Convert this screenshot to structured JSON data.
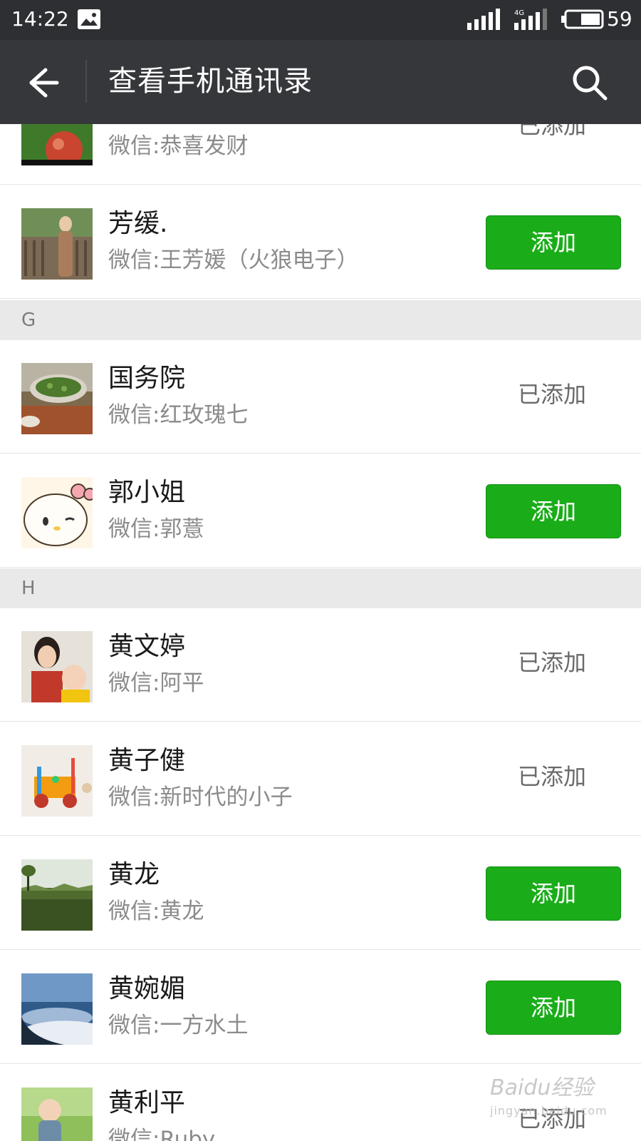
{
  "status_bar": {
    "time": "14:22",
    "battery_level": "59",
    "network": "4G"
  },
  "header": {
    "title": "查看手机通讯录",
    "back_icon": "arrow-left-icon",
    "search_icon": "search-icon"
  },
  "colors": {
    "header_bg": "#36373b",
    "status_bg": "#2e2f33",
    "add_button": "#1aad19",
    "section_bg": "#e9e9ea"
  },
  "list": {
    "rows": [
      {
        "name": "",
        "wechat": "微信:恭喜发财",
        "status": "已添加"
      },
      {
        "name": "芳缓.",
        "wechat": "微信:王芳媛（火狼电子）",
        "action": "添加"
      },
      {
        "section": "G"
      },
      {
        "name": "国务院",
        "wechat": "微信:红玫瑰七",
        "status": "已添加"
      },
      {
        "name": "郭小姐",
        "wechat": "微信:郭薏",
        "action": "添加"
      },
      {
        "section": "H"
      },
      {
        "name": "黄文婷",
        "wechat": "微信:阿平",
        "status": "已添加"
      },
      {
        "name": "黄子健",
        "wechat": "微信:新时代的小子",
        "status": "已添加"
      },
      {
        "name": "黄龙",
        "wechat": "微信:黄龙",
        "action": "添加"
      },
      {
        "name": "黄婉媚",
        "wechat": "微信:一方水土",
        "action": "添加"
      },
      {
        "name": "黄利平",
        "wechat": "微信:Ruby",
        "status": "已添加"
      }
    ]
  },
  "watermark": {
    "brand": "Baidu经验",
    "url": "jingyan.baidu.com"
  }
}
